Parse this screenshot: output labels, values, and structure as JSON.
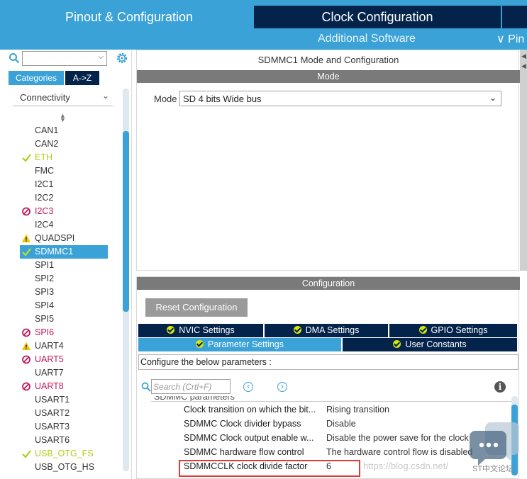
{
  "header": {
    "tabs": [
      {
        "label": "Pinout & Configuration",
        "active": true
      },
      {
        "label": "Clock Configuration",
        "active": false
      },
      {
        "label": "",
        "active": false
      }
    ],
    "additional_software": "Additional Software",
    "pin_menu": "∨ Pin"
  },
  "sidebar": {
    "search_value": "",
    "tabs": [
      {
        "label": "Categories"
      },
      {
        "label": "A->Z"
      }
    ],
    "category": "Connectivity",
    "items": [
      {
        "label": "CAN1",
        "status": "normal"
      },
      {
        "label": "CAN2",
        "status": "normal"
      },
      {
        "label": "ETH",
        "status": "ok"
      },
      {
        "label": "FMC",
        "status": "normal"
      },
      {
        "label": "I2C1",
        "status": "normal"
      },
      {
        "label": "I2C2",
        "status": "normal"
      },
      {
        "label": "I2C3",
        "status": "error"
      },
      {
        "label": "I2C4",
        "status": "normal"
      },
      {
        "label": "QUADSPI",
        "status": "warning"
      },
      {
        "label": "SDMMC1",
        "status": "selected"
      },
      {
        "label": "SPI1",
        "status": "normal"
      },
      {
        "label": "SPI2",
        "status": "normal"
      },
      {
        "label": "SPI3",
        "status": "normal"
      },
      {
        "label": "SPI4",
        "status": "normal"
      },
      {
        "label": "SPI5",
        "status": "normal"
      },
      {
        "label": "SPI6",
        "status": "error"
      },
      {
        "label": "UART4",
        "status": "warning"
      },
      {
        "label": "UART5",
        "status": "error"
      },
      {
        "label": "UART7",
        "status": "normal"
      },
      {
        "label": "UART8",
        "status": "error"
      },
      {
        "label": "USART1",
        "status": "normal"
      },
      {
        "label": "USART2",
        "status": "normal"
      },
      {
        "label": "USART3",
        "status": "normal"
      },
      {
        "label": "USART6",
        "status": "normal"
      },
      {
        "label": "USB_OTG_FS",
        "status": "ok"
      },
      {
        "label": "USB_OTG_HS",
        "status": "normal"
      }
    ]
  },
  "mode_panel": {
    "title": "SDMMC1 Mode and Configuration",
    "header": "Mode",
    "mode_label": "Mode",
    "mode_value": "SD 4 bits Wide bus"
  },
  "config_panel": {
    "header": "Configuration",
    "reset_label": "Reset Configuration",
    "tabs_row1": [
      {
        "label": "NVIC Settings"
      },
      {
        "label": "DMA Settings"
      },
      {
        "label": "GPIO Settings"
      }
    ],
    "tabs_row2": [
      {
        "label": "Parameter Settings",
        "active": true
      },
      {
        "label": "User Constants",
        "active": false
      }
    ],
    "hint": "Configure the below parameters :",
    "search_placeholder": "Search (Crtl+F)",
    "group_header": "SDMMC parameters",
    "parameters": [
      {
        "name": "Clock transition on which the bit...",
        "value": "Rising transition"
      },
      {
        "name": "SDMMC Clock divider bypass",
        "value": "Disable"
      },
      {
        "name": "SDMMC Clock output enable w...",
        "value": "Disable the power save for the clock"
      },
      {
        "name": "SDMMC hardware flow control",
        "value": "The hardware control flow is disabled"
      },
      {
        "name": "SDMMCCLK clock divide factor",
        "value": "6"
      }
    ]
  },
  "watermark": {
    "url": "https://blog.csdn.net/",
    "label": "ST中文论坛"
  },
  "colors": {
    "accent": "#3aa2d7",
    "dark": "#03234b",
    "highlight": "#e53935",
    "ok": "#b5cb15",
    "error": "#c2185b",
    "warning": "#f5c400"
  }
}
